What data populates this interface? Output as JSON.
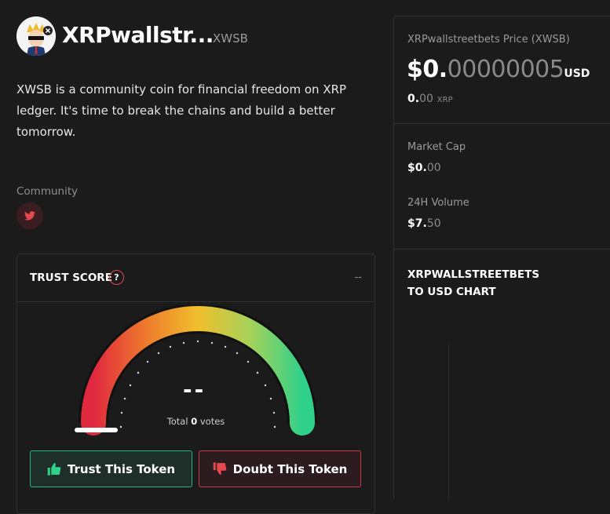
{
  "token": {
    "name": "XRPwallstr...",
    "symbol": "XWSB",
    "description": "XWSB is a community coin for financial freedom on XRP ledger. It's time to break the chains and build a better tomorrow.",
    "community_label": "Community"
  },
  "trust": {
    "title": "TRUST SCORE",
    "help": "?",
    "header_value": "--",
    "score": "--",
    "votes_prefix": "Total",
    "votes_count": "0",
    "votes_suffix": "votes",
    "trust_button": "Trust This Token",
    "doubt_button": "Doubt This Token"
  },
  "price": {
    "label": "XRPwallstreetbets Price (XWSB)",
    "main_bold": "$0.",
    "main_dim": "00000005",
    "currency": "USD",
    "xrp_bold": "0.",
    "xrp_dim": "00",
    "xrp_currency": "XRP"
  },
  "stats": {
    "market_cap_label": "Market Cap",
    "market_cap_bold": "$0.",
    "market_cap_dim": "00",
    "volume_label": "24H Volume",
    "volume_bold": "$7.",
    "volume_dim": "50"
  },
  "chart": {
    "title_line1": "XRPWALLSTREETBETS",
    "title_line2": "TO USD CHART"
  },
  "colors": {
    "background": "#1b1b1b",
    "trust_green": "#27b47f",
    "doubt_red": "#c53a48",
    "twitter_red": "#e5484d"
  },
  "icons": [
    "twitter-icon",
    "help-icon",
    "thumbs-up-icon",
    "thumbs-down-icon"
  ]
}
